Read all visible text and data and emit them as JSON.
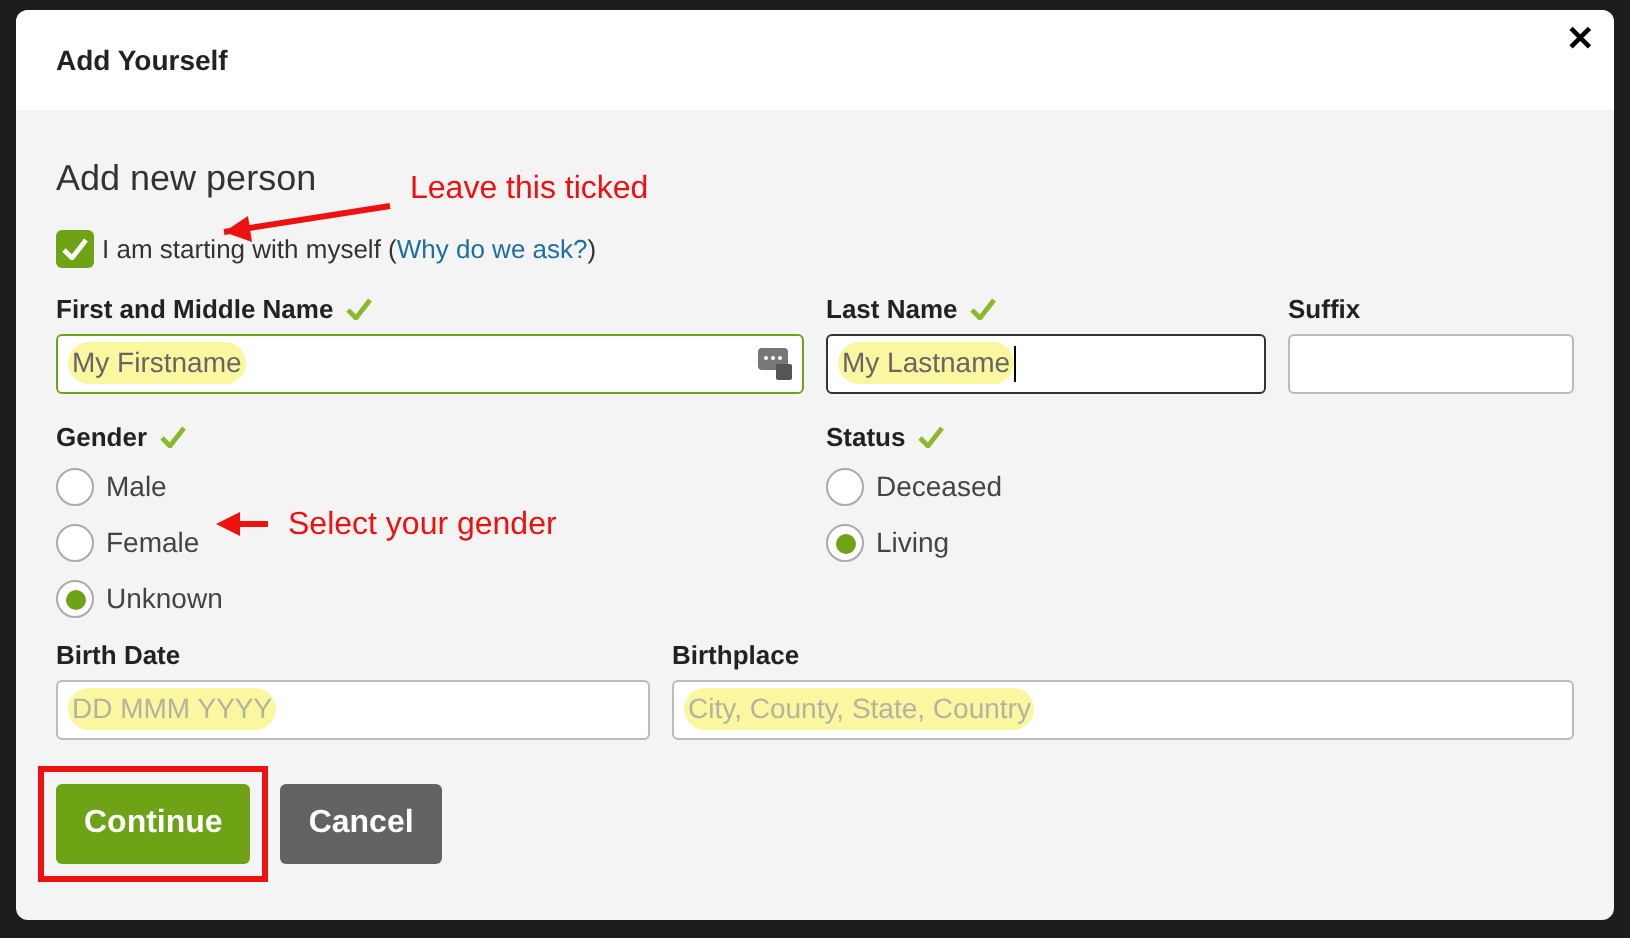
{
  "dialog": {
    "title": "Add Yourself",
    "close": "✕"
  },
  "section_title": "Add new person",
  "self_checkbox": {
    "label": "I am starting with myself (",
    "link": "Why do we ask?",
    "suffix": ")",
    "checked": true
  },
  "name_fields": [
    {
      "label": "First and Middle Name",
      "valid": true,
      "value": "My Firstname",
      "has_icon": true,
      "focused": true
    },
    {
      "label": "Last Name",
      "valid": true,
      "value": "My Lastname",
      "has_icon": false,
      "focused": false,
      "cursor": true
    },
    {
      "label": "Suffix",
      "valid": false,
      "has_icon": false,
      "focused": false
    }
  ],
  "gender": {
    "label": "Gender",
    "valid": true,
    "options": [
      {
        "label": "Male",
        "selected": false
      },
      {
        "label": "Female",
        "selected": false
      },
      {
        "label": "Unknown",
        "selected": true
      }
    ]
  },
  "status": {
    "label": "Status",
    "valid": true,
    "options": [
      {
        "label": "Deceased",
        "selected": false
      },
      {
        "label": "Living",
        "selected": true
      }
    ]
  },
  "birth_fields": [
    {
      "label": "Birth Date",
      "placeholder": "DD MMM YYYY"
    },
    {
      "label": "Birthplace",
      "placeholder": "City, County, State, Country"
    }
  ],
  "buttons": [
    {
      "label": "Continue",
      "kind": "primary",
      "outlined": true
    },
    {
      "label": "Cancel",
      "kind": "secondary",
      "outlined": false
    }
  ],
  "annotations": [
    {
      "text": "Leave this ticked",
      "kind": "tick"
    },
    {
      "text": "Select your gender",
      "kind": "gender"
    }
  ]
}
